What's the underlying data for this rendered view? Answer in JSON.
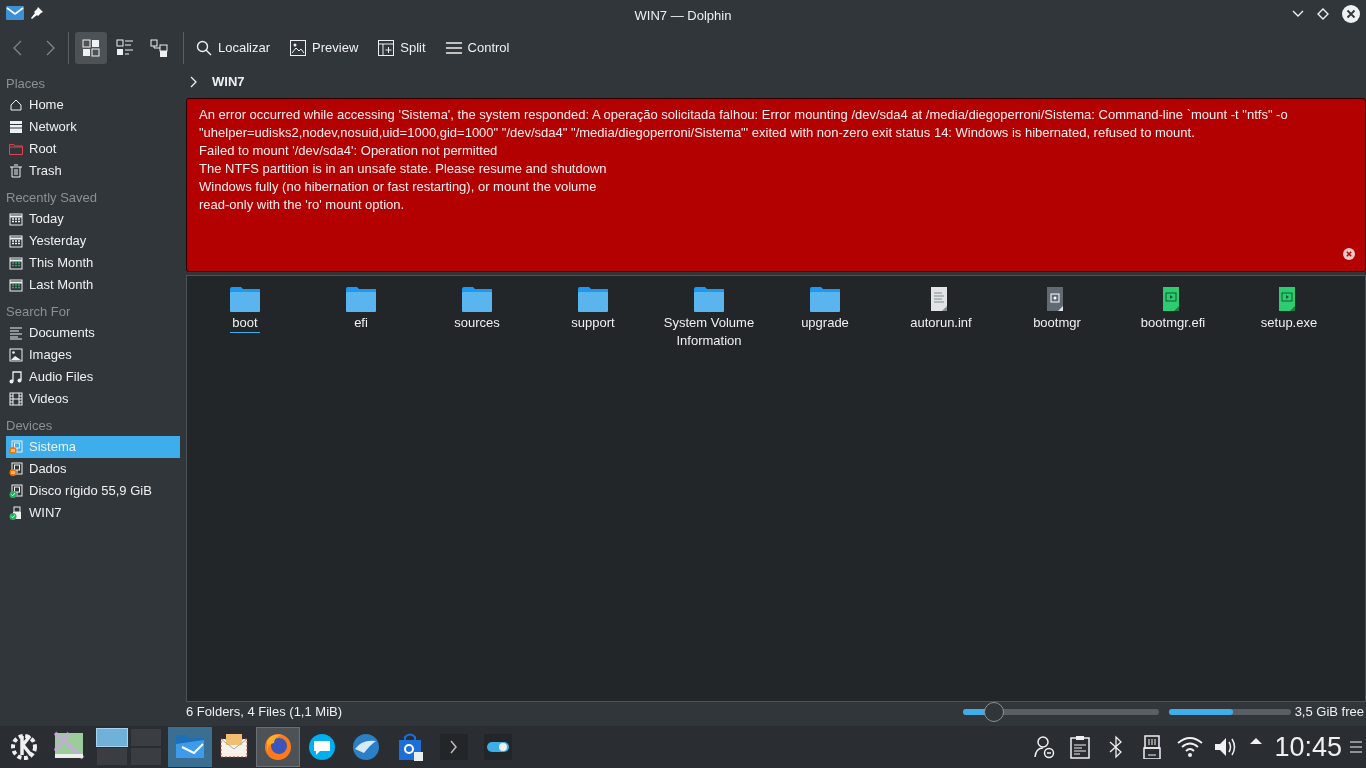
{
  "window": {
    "title": "WIN7 — Dolphin"
  },
  "toolbar": {
    "view_modes": [
      {
        "kind": "icons",
        "selected": true
      },
      {
        "kind": "compact",
        "selected": false
      },
      {
        "kind": "details",
        "selected": false
      }
    ],
    "actions": [
      {
        "kind": "search",
        "label": "Localizar"
      },
      {
        "kind": "preview",
        "label": "Preview"
      },
      {
        "kind": "split",
        "label": "Split"
      },
      {
        "kind": "menu",
        "label": "Control"
      }
    ]
  },
  "breadcrumb": {
    "path": "WIN7"
  },
  "sidebar": {
    "sections": [
      {
        "title": "Places",
        "items": [
          {
            "kind": "home",
            "label": "Home",
            "selected": false
          },
          {
            "kind": "network",
            "label": "Network",
            "selected": false
          },
          {
            "kind": "root",
            "label": "Root",
            "selected": false
          },
          {
            "kind": "trash",
            "label": "Trash",
            "selected": false
          }
        ]
      },
      {
        "title": "Recently Saved",
        "items": [
          {
            "kind": "day",
            "label": "Today",
            "selected": false
          },
          {
            "kind": "day",
            "label": "Yesterday",
            "selected": false
          },
          {
            "kind": "month",
            "label": "This Month",
            "selected": false
          },
          {
            "kind": "month",
            "label": "Last Month",
            "selected": false
          }
        ]
      },
      {
        "title": "Search For",
        "items": [
          {
            "kind": "documents",
            "label": "Documents",
            "selected": false
          },
          {
            "kind": "images",
            "label": "Images",
            "selected": false
          },
          {
            "kind": "audio",
            "label": "Audio Files",
            "selected": false
          },
          {
            "kind": "videos",
            "label": "Videos",
            "selected": false
          }
        ]
      },
      {
        "title": "Devices",
        "items": [
          {
            "kind": "drive",
            "label": "Sistema",
            "selected": true,
            "mounted": false
          },
          {
            "kind": "drive",
            "label": "Dados",
            "selected": false,
            "mounted": false
          },
          {
            "kind": "drive",
            "label": "Disco rígido 55,9 GiB",
            "selected": false,
            "mounted": true
          },
          {
            "kind": "usb",
            "label": "WIN7",
            "selected": false,
            "mounted": true
          }
        ]
      }
    ]
  },
  "error": {
    "lines": [
      "An error occurred while accessing 'Sistema', the system responded: A operação solicitada falhou: Error mounting /dev/sda4 at /media/diegoperroni/Sistema: Command-line `mount -t \"ntfs\" -o \"uhelper=udisks2,nodev,nosuid,uid=1000,gid=1000\" \"/dev/sda4\" \"/media/diegoperroni/Sistema\"' exited with non-zero exit status 14: Windows is hibernated, refused to mount.",
      "Failed to mount '/dev/sda4': Operation not permitted",
      "The NTFS partition is in an unsafe state. Please resume and shutdown",
      "Windows fully (no hibernation or fast restarting), or mount the volume",
      "read-only with the 'ro' mount option."
    ]
  },
  "files": [
    {
      "kind": "folder",
      "name": "boot",
      "current": true
    },
    {
      "kind": "folder",
      "name": "efi",
      "current": false
    },
    {
      "kind": "folder",
      "name": "sources",
      "current": false
    },
    {
      "kind": "folder",
      "name": "support",
      "current": false
    },
    {
      "kind": "folder",
      "name": "System Volume Information",
      "current": false
    },
    {
      "kind": "folder",
      "name": "upgrade",
      "current": false
    },
    {
      "kind": "text",
      "name": "autorun.inf",
      "current": false
    },
    {
      "kind": "unknown",
      "name": "bootmgr",
      "current": false
    },
    {
      "kind": "exec",
      "name": "bootmgr.efi",
      "current": false
    },
    {
      "kind": "exec",
      "name": "setup.exe",
      "current": false
    }
  ],
  "status_bar": {
    "summary": "6 Folders, 4 Files (1,1 MiB)",
    "zoom": {
      "level": 0.16
    },
    "space": {
      "level": 0.53
    },
    "free": "3,5 GiB free"
  },
  "taskbar": {
    "apps": [
      {
        "kind": "launcher",
        "active": false
      },
      {
        "kind": "viewer",
        "active": false
      },
      {
        "kind": "pager",
        "desktops": [
          {
            "selected": true
          },
          {
            "selected": false
          },
          {
            "selected": false
          },
          {
            "selected": false
          }
        ]
      },
      {
        "kind": "files",
        "active": true
      },
      {
        "kind": "mail",
        "active": false
      },
      {
        "kind": "browser",
        "active": true
      },
      {
        "kind": "chat",
        "active": false
      },
      {
        "kind": "bird",
        "active": false
      },
      {
        "kind": "store",
        "active": false
      },
      {
        "kind": "terminal",
        "active": false
      },
      {
        "kind": "toggle",
        "active": false
      }
    ],
    "tray": [
      {
        "kind": "user"
      },
      {
        "kind": "clipboard"
      },
      {
        "kind": "bluetooth"
      },
      {
        "kind": "usb"
      },
      {
        "kind": "wifi"
      },
      {
        "kind": "volume"
      },
      {
        "kind": "expand"
      }
    ],
    "clock": "10:45"
  }
}
